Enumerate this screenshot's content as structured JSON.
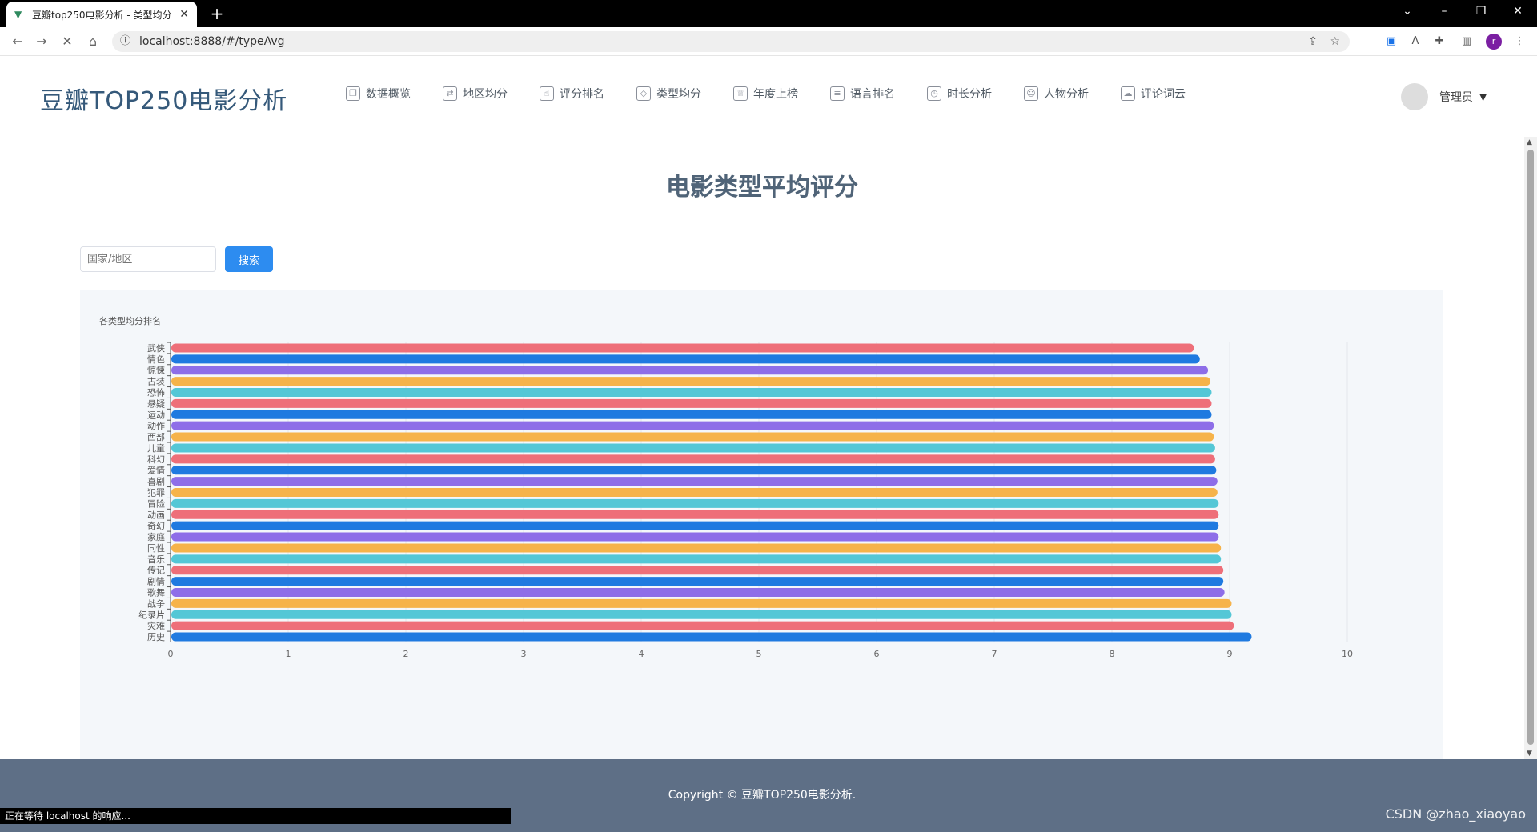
{
  "browser": {
    "tab_title": "豆瓣top250电影分析 - 类型均分",
    "url": "localhost:8888/#/typeAvg",
    "status_text": "正在等待 localhost 的响应...",
    "profile_initial": "r"
  },
  "header": {
    "brand": "豆瓣TOP250电影分析",
    "nav": [
      {
        "label": "数据概览",
        "icon": "copy-icon"
      },
      {
        "label": "地区均分",
        "icon": "swap-icon"
      },
      {
        "label": "评分排名",
        "icon": "thumb-up-icon"
      },
      {
        "label": "类型均分",
        "icon": "tag-icon"
      },
      {
        "label": "年度上榜",
        "icon": "trophy-icon"
      },
      {
        "label": "语言排名",
        "icon": "list-icon"
      },
      {
        "label": "时长分析",
        "icon": "clock-icon"
      },
      {
        "label": "人物分析",
        "icon": "user-icon"
      },
      {
        "label": "评论词云",
        "icon": "cloud-icon"
      }
    ],
    "user_name": "管理员"
  },
  "page": {
    "title": "电影类型平均评分",
    "search_placeholder": "国家/地区",
    "search_button": "搜索",
    "chart_title": "各类型均分排名"
  },
  "footer": {
    "copyright": "Copyright © 豆瓣TOP250电影分析.",
    "watermark": "CSDN @zhao_xiaoyao"
  },
  "chart_data": {
    "type": "bar",
    "orientation": "horizontal",
    "title": "各类型均分排名",
    "categories": [
      "武侠",
      "情色",
      "惊悚",
      "古装",
      "恐怖",
      "悬疑",
      "运动",
      "动作",
      "西部",
      "儿童",
      "科幻",
      "爱情",
      "喜剧",
      "犯罪",
      "冒险",
      "动画",
      "奇幻",
      "家庭",
      "同性",
      "音乐",
      "传记",
      "剧情",
      "歌舞",
      "战争",
      "纪录片",
      "灾难",
      "历史"
    ],
    "values": [
      8.69,
      8.74,
      8.81,
      8.83,
      8.84,
      8.84,
      8.84,
      8.86,
      8.86,
      8.87,
      8.87,
      8.88,
      8.89,
      8.89,
      8.9,
      8.9,
      8.9,
      8.9,
      8.92,
      8.92,
      8.94,
      8.94,
      8.95,
      9.01,
      9.01,
      9.03,
      9.18
    ],
    "colors": [
      "#ee6f79",
      "#1f7ae0",
      "#8e6ee8",
      "#f6b34a",
      "#54c7d6"
    ],
    "xlim": [
      0,
      10
    ],
    "xticks": [
      0,
      1,
      2,
      3,
      4,
      5,
      6,
      7,
      8,
      9,
      10
    ],
    "grid": true
  }
}
